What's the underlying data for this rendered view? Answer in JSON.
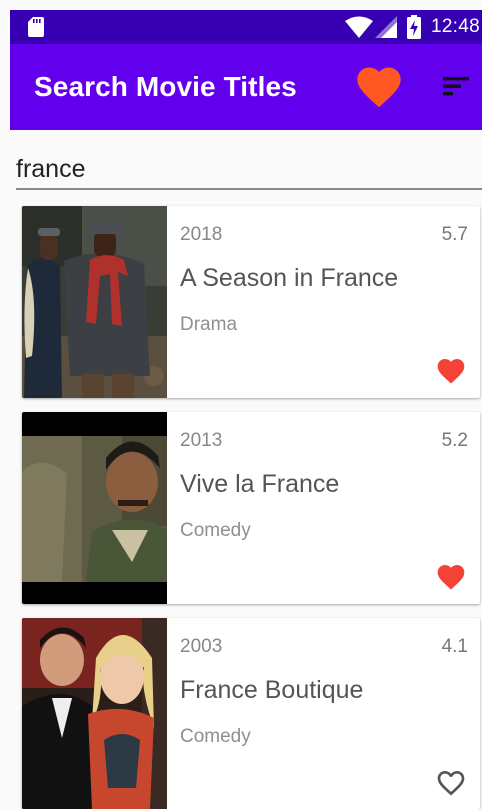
{
  "status_bar": {
    "time": "12:48",
    "background": "#3700b3"
  },
  "app_bar": {
    "title": "Search Movie Titles",
    "background": "#6200ee",
    "favorites_icon": "heart-icon",
    "favorites_color": "#ff5722",
    "sort_icon": "sort-icon"
  },
  "search": {
    "value": "france"
  },
  "favorite_color": "#f44336",
  "movies": [
    {
      "year": "2018",
      "rating": "5.7",
      "title": "A Season in France",
      "genre": "Drama",
      "favorite": true
    },
    {
      "year": "2013",
      "rating": "5.2",
      "title": "Vive la France",
      "genre": "Comedy",
      "favorite": true
    },
    {
      "year": "2003",
      "rating": "4.1",
      "title": "France Boutique",
      "genre": "Comedy",
      "favorite": false
    }
  ]
}
